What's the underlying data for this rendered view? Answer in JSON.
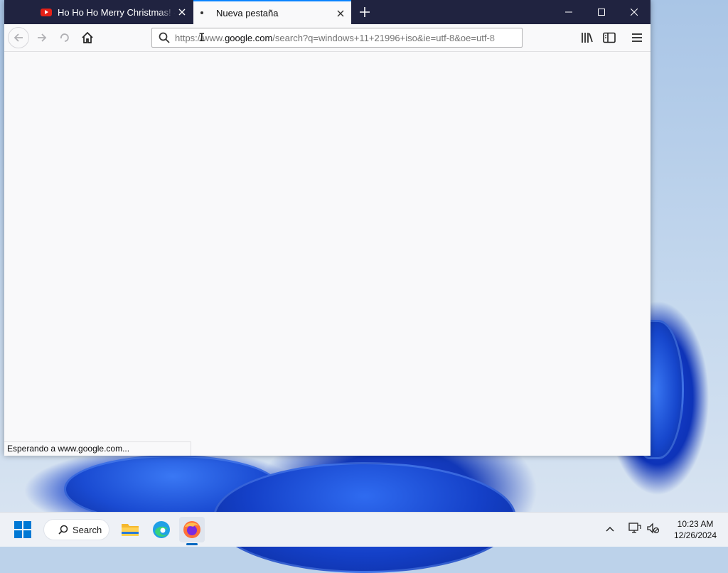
{
  "browser": {
    "tabs": [
      {
        "title": "Ho Ho Ho Merry Christmas! - YouTube",
        "favicon": "youtube-icon",
        "active": false
      },
      {
        "title": "Nueva pestaña",
        "favicon": "loading-dot-icon",
        "active": true
      }
    ],
    "url": {
      "prefix": "https://www.",
      "host": "google.com",
      "rest": "/search?q=windows+11+21996+iso&ie=utf-8&oe=utf-8"
    },
    "status_text": "Esperando a www.google.com...",
    "icons": {
      "back": "back-arrow-icon",
      "forward": "forward-arrow-icon",
      "reload": "reload-icon",
      "home": "home-icon",
      "search": "search-icon",
      "library": "library-icon",
      "sidebar": "sidebar-icon",
      "menu": "hamburger-menu-icon"
    },
    "accent_color": "#0a84ff",
    "titlebar_color": "#202340"
  },
  "taskbar": {
    "search_label": "Search",
    "pinned": [
      "start-icon",
      "file-explorer-icon",
      "edge-icon",
      "firefox-icon"
    ],
    "active_app": "firefox-icon",
    "time": "10:23 AM",
    "date": "12/26/2024"
  }
}
